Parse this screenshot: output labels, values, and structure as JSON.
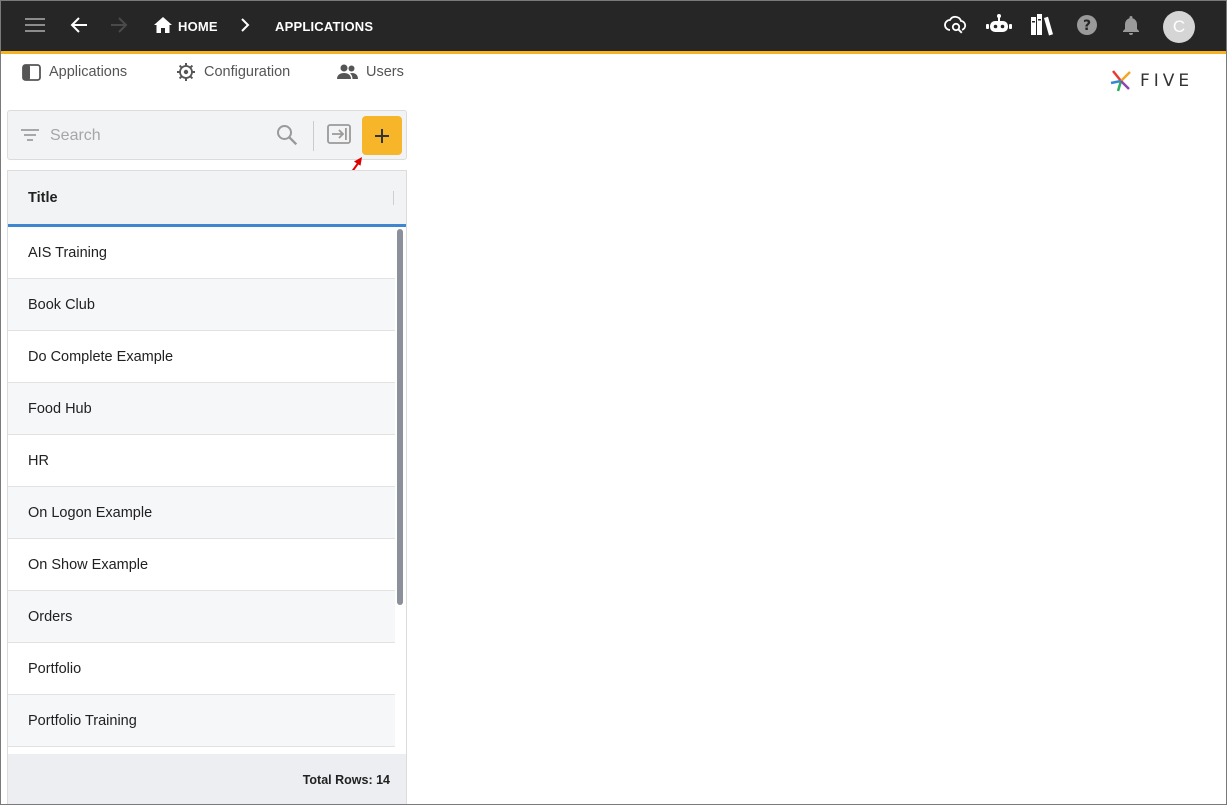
{
  "breadcrumb": {
    "home": "HOME",
    "current": "APPLICATIONS"
  },
  "icons": {
    "menu": "menu-icon",
    "back": "arrow-left-icon",
    "forward": "arrow-right-icon",
    "home": "home-icon",
    "cloud": "cloud-search-icon",
    "chat": "chatbot-icon",
    "library": "library-icon",
    "help": "help-icon",
    "bell": "bell-icon"
  },
  "user": {
    "initial": "C"
  },
  "tabs": [
    {
      "label": "Applications"
    },
    {
      "label": "Configuration"
    },
    {
      "label": "Users"
    }
  ],
  "logo": {
    "text": "FIVE"
  },
  "search": {
    "placeholder": "Search"
  },
  "list": {
    "column_title": "Title",
    "items": [
      "AIS Training",
      "Book Club",
      "Do Complete Example",
      "Food Hub",
      "HR",
      "On Logon Example",
      "On Show Example",
      "Orders",
      "Portfolio",
      "Portfolio Training"
    ],
    "footer": "Total Rows: 14"
  },
  "colors": {
    "topbar": "#262626",
    "accent": "#f5b324",
    "add_button": "#f7b529",
    "header_underline": "#3e86cf"
  }
}
